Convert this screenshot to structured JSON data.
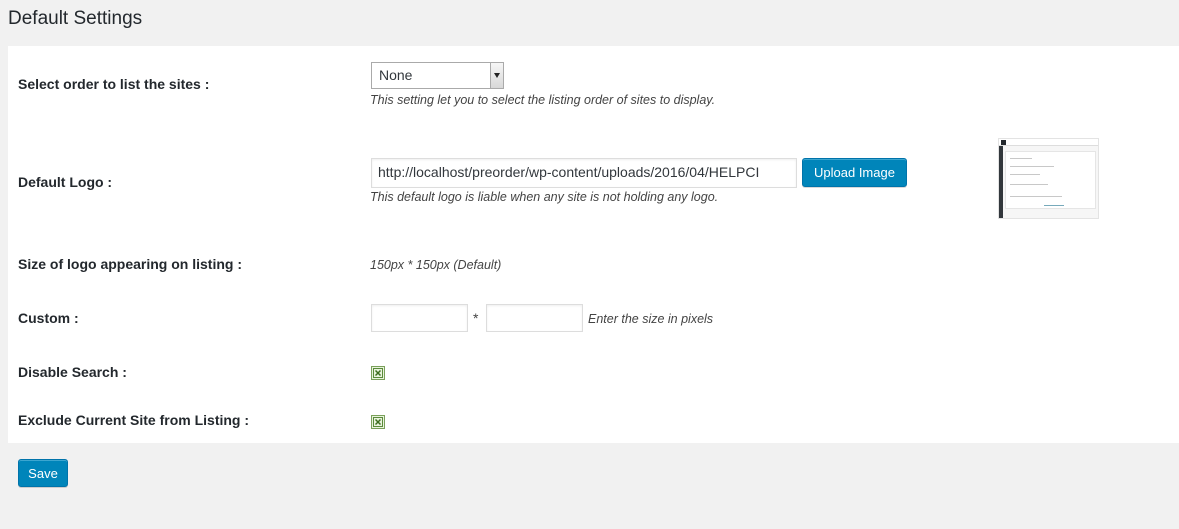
{
  "page_title": "Default Settings",
  "settings": {
    "order": {
      "label": "Select order to list the sites :",
      "selected": "None",
      "description": "This setting let you to select the listing order of sites to display."
    },
    "logo": {
      "label": "Default Logo :",
      "value": "http://localhost/preorder/wp-content/uploads/2016/04/HELPCI",
      "button": "Upload Image",
      "description": "This default logo is liable when any site is not holding any logo."
    },
    "logo_size": {
      "label": "Size of logo appearing on listing :",
      "value": "150px * 150px (Default)"
    },
    "custom": {
      "label": "Custom :",
      "width_value": "",
      "height_value": "",
      "separator": "*",
      "hint": "Enter the size in pixels"
    },
    "disable_search": {
      "label": "Disable Search :",
      "checked": true
    },
    "exclude_current": {
      "label": "Exclude Current Site from Listing :",
      "checked": true
    }
  },
  "save_button": "Save",
  "colors": {
    "primary_button": "#0085ba",
    "checkbox_green": "#5a8a3a"
  },
  "icons": {
    "checkbox": "check-x-icon",
    "select_arrow": "chevron-down-icon"
  }
}
